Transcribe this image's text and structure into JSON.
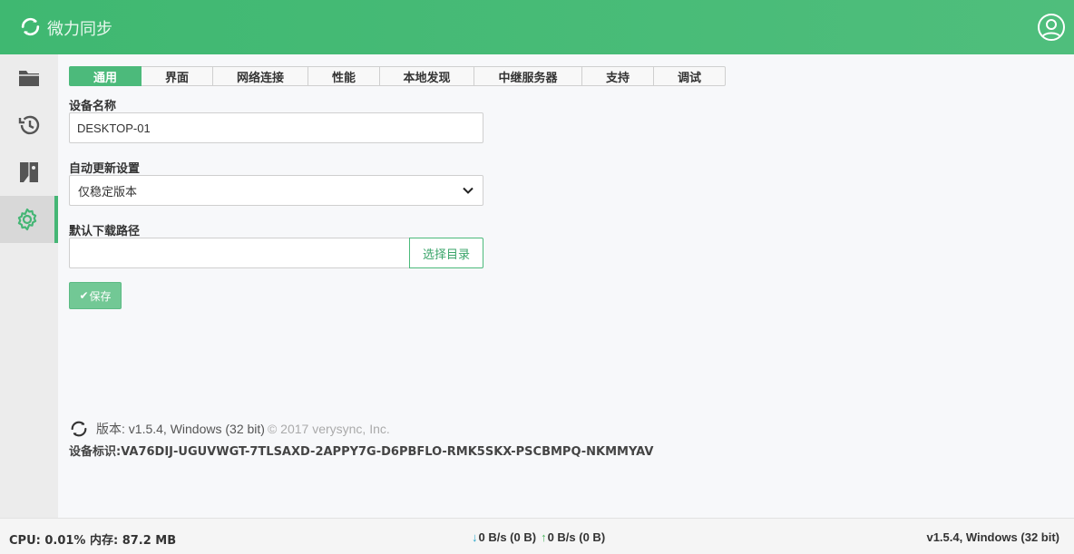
{
  "header": {
    "title": "微力同步"
  },
  "sidebar": {
    "items": [
      {
        "name": "folders",
        "icon": "folder-icon"
      },
      {
        "name": "history",
        "icon": "history-icon"
      },
      {
        "name": "devices",
        "icon": "device-icon"
      },
      {
        "name": "settings",
        "icon": "gear-icon",
        "active": true
      }
    ]
  },
  "tabs": [
    {
      "label": "通用",
      "active": true
    },
    {
      "label": "界面"
    },
    {
      "label": "网络连接"
    },
    {
      "label": "性能"
    },
    {
      "label": "本地发现"
    },
    {
      "label": "中继服务器"
    },
    {
      "label": "支持"
    },
    {
      "label": "调试"
    }
  ],
  "form": {
    "device_name_label": "设备名称",
    "device_name_value": "DESKTOP-01",
    "auto_update_label": "自动更新设置",
    "auto_update_value": "仅稳定版本",
    "download_path_label": "默认下载路径",
    "download_path_value": "",
    "browse_button": "选择目录",
    "save_button": "保存"
  },
  "about": {
    "version_text": "版本: v1.5.4, Windows (32 bit)",
    "copyright": "© 2017 verysync, Inc.",
    "device_id": "设备标识:VA76DIJ-UGUVWGT-7TLSAXD-2APPY7G-D6PBFLO-RMK5SKX-PSCBMPQ-NKMMYAV"
  },
  "footer": {
    "cpu_mem": "CPU: 0.01% 内存: 87.2 MB",
    "down_rate": "0 B/s (0 B)",
    "up_rate": "0 B/s (0 B)",
    "version": "v1.5.4, Windows (32 bit)"
  },
  "colors": {
    "accent": "#4cba7b",
    "header": "#45b675"
  }
}
